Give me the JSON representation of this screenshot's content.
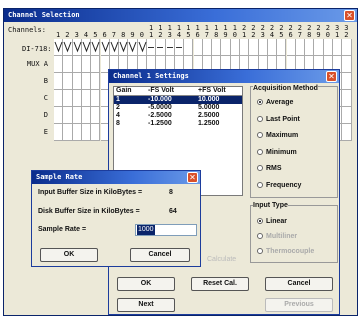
{
  "channel_selection": {
    "title": "Channel Selection",
    "channels_label": "Channels:",
    "tens_digits": [
      "1",
      "1",
      "1",
      "1",
      "1",
      "1",
      "1",
      "1",
      "1",
      "1",
      "2",
      "2",
      "2",
      "2",
      "2",
      "2",
      "2",
      "2",
      "2",
      "2",
      "3",
      "3"
    ],
    "units_digits": [
      "1",
      "2",
      "3",
      "4",
      "5",
      "6",
      "7",
      "8",
      "9",
      "0",
      "1",
      "2",
      "3",
      "4",
      "5",
      "6",
      "7",
      "8",
      "9",
      "0",
      "1",
      "2",
      "3",
      "4",
      "5",
      "6",
      "7",
      "8",
      "9",
      "0",
      "1",
      "2"
    ],
    "di_label": "DI-718:",
    "row_labels": [
      "MUX A",
      "B",
      "C",
      "D",
      "E"
    ]
  },
  "channel_settings": {
    "title": "Channel 1 Settings",
    "table_headers": [
      "Gain",
      "-FS Volt",
      "+FS Volt"
    ],
    "table_rows": [
      [
        "1",
        "-10.000",
        "10.000"
      ],
      [
        "2",
        "-5.0000",
        "5.0000"
      ],
      [
        "4",
        "-2.5000",
        "2.5000"
      ],
      [
        "8",
        "-1.2500",
        "1.2500"
      ]
    ],
    "acquisition_title": "Acquisition Method",
    "acquisition_options": [
      "Average",
      "Last Point",
      "Maximum",
      "Minimum",
      "RMS",
      "Frequency"
    ],
    "input_type_title": "Input Type",
    "input_type_options": [
      "Linear",
      "Multiliner",
      "Thermocouple"
    ],
    "hidden_label": "Calculate",
    "ok_label": "OK",
    "reset_label": "Reset Cal.",
    "cancel_label": "Cancel",
    "next_label": "Next",
    "previous_label": "Previous"
  },
  "sample_rate": {
    "title": "Sample Rate",
    "input_buffer_label": "Input Buffer Size in KiloBytes =",
    "input_buffer_value": "8",
    "disk_buffer_label": "Disk Buffer Size in KiloBytes =",
    "disk_buffer_value": "64",
    "rate_label": "Sample Rate =",
    "rate_value": "1000",
    "ok_label": "OK",
    "cancel_label": "Cancel"
  },
  "colors": {
    "title_start": "#0a2c8c",
    "title_end": "#6a9ae8",
    "selection": "#0a246a",
    "close": "#d8502a"
  }
}
